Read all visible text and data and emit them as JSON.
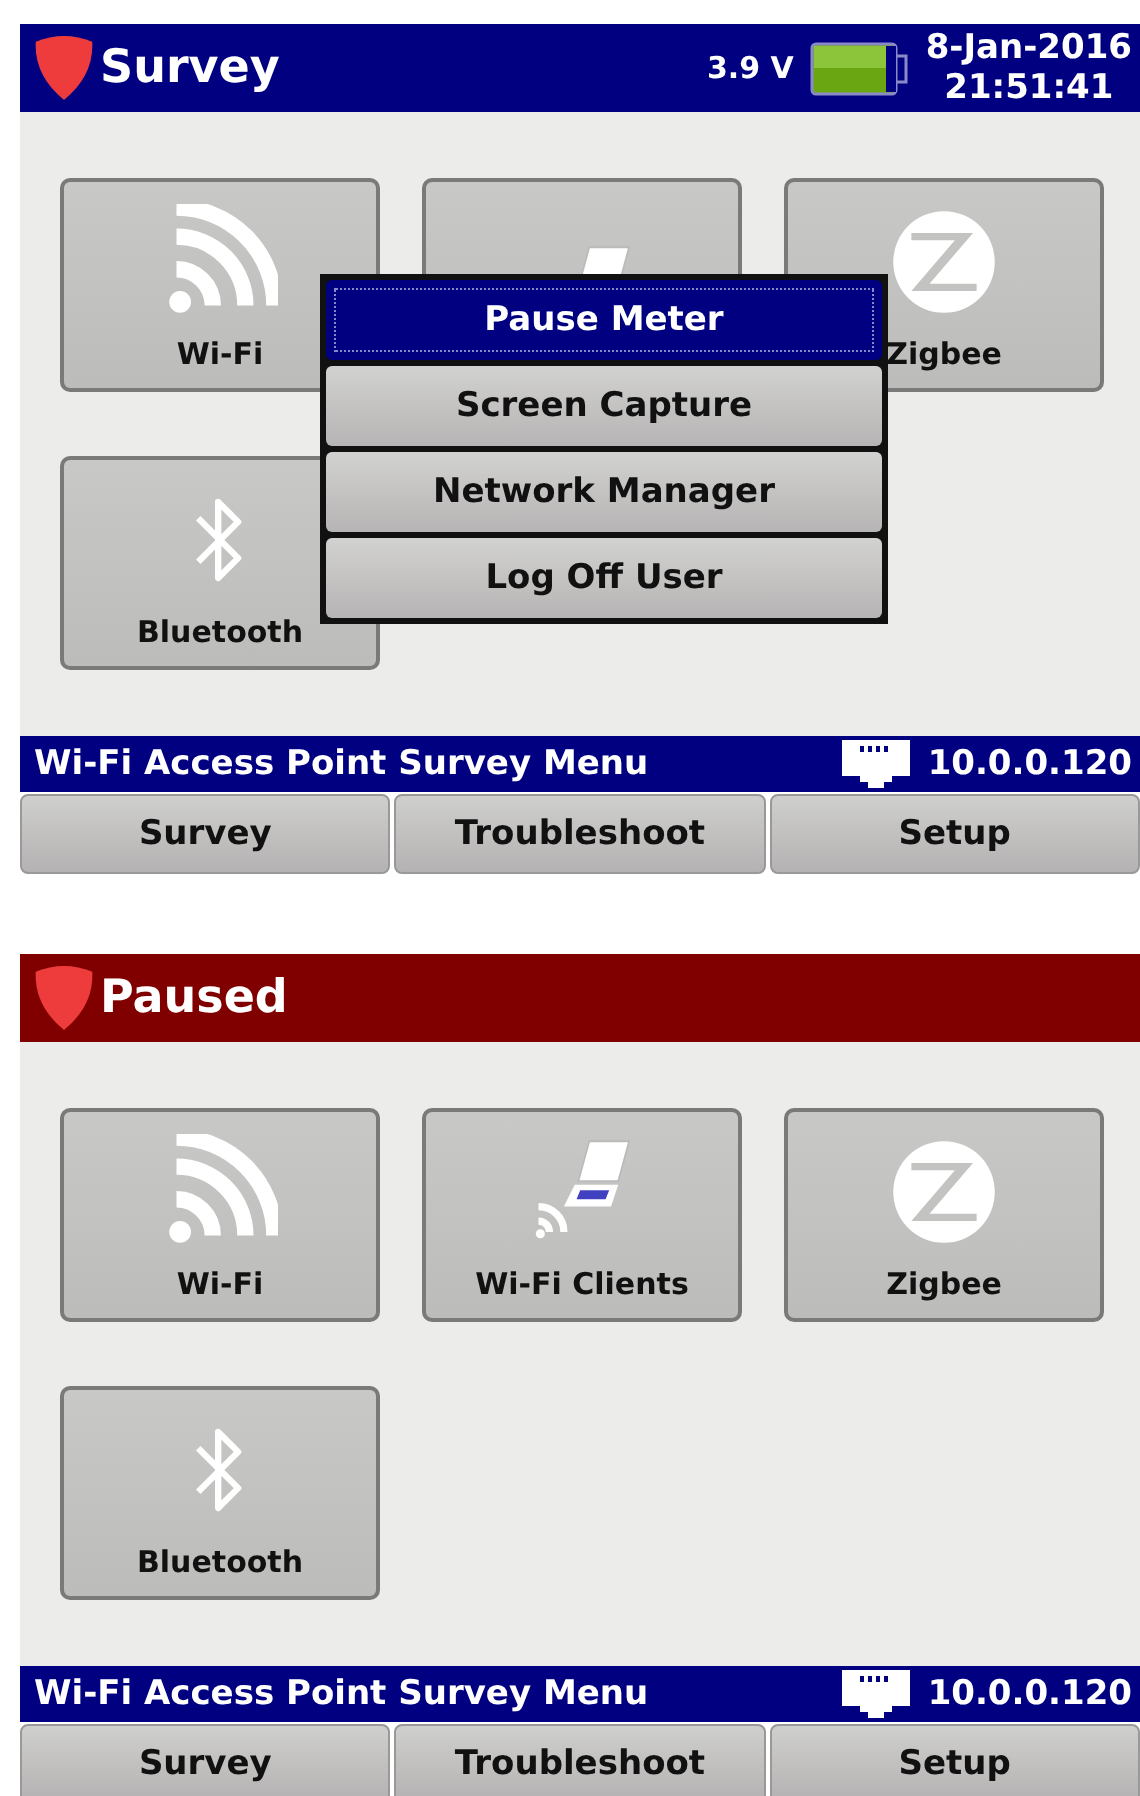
{
  "screens": [
    {
      "header": {
        "kind": "normal",
        "title": "Survey",
        "voltage": "3.9 V",
        "date": "8-Jan-2016",
        "time": "21:51:41"
      },
      "tiles": [
        {
          "kind": "wifi",
          "label": "Wi-Fi"
        },
        {
          "kind": "clients"
        },
        {
          "kind": "zigbee",
          "label": "Zigbee"
        },
        {
          "kind": "bluetooth",
          "label": "Bluetooth"
        }
      ],
      "menu": [
        {
          "label": "Pause Meter",
          "selected": true
        },
        {
          "label": "Screen Capture",
          "selected": false
        },
        {
          "label": "Network Manager",
          "selected": false
        },
        {
          "label": "Log Off User",
          "selected": false
        }
      ],
      "status_bar": {
        "text": "Wi-Fi Access Point Survey Menu",
        "ip": "10.0.0.120"
      },
      "tabs": [
        {
          "label": "Survey"
        },
        {
          "label": "Troubleshoot"
        },
        {
          "label": "Setup"
        }
      ]
    },
    {
      "header": {
        "kind": "paused",
        "title": "Paused"
      },
      "tiles": [
        {
          "kind": "wifi",
          "label": "Wi-Fi"
        },
        {
          "kind": "clients",
          "label": "Wi-Fi Clients"
        },
        {
          "kind": "zigbee",
          "label": "Zigbee"
        },
        {
          "kind": "bluetooth",
          "label": "Bluetooth"
        }
      ],
      "status_bar": {
        "text": "Wi-Fi Access Point Survey Menu",
        "ip": "10.0.0.120"
      },
      "tabs": [
        {
          "label": "Survey"
        },
        {
          "label": "Troubleshoot"
        },
        {
          "label": "Setup"
        }
      ]
    }
  ]
}
